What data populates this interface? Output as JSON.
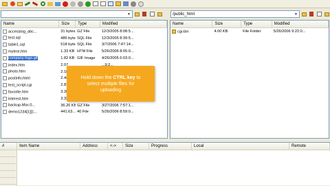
{
  "toolbar": {
    "icons": [
      "folder-icon",
      "wizard-icon",
      "open-icon",
      "connect-icon",
      "disconnect-icon",
      "refresh-icon",
      "upload-icon",
      "download-icon",
      "delete-icon",
      "stop-icon",
      "skip-icon",
      "go-icon",
      "queue-icon",
      "view-icon",
      "log-icon",
      "properties-icon",
      "bookmark-icon",
      "settings-icon",
      "help-icon"
    ]
  },
  "left_path": {
    "value": ""
  },
  "right_path": {
    "value": "/public_html"
  },
  "left_panel": {
    "headers": [
      "Name",
      "Size",
      "Type",
      "Modified"
    ],
    "rows": [
      {
        "name": "accesslog_abc...",
        "size": "31 bytes",
        "type": "GZ File",
        "modified": "12/3/2005 8:08:5..."
      },
      {
        "name": "test.sql",
        "size": "486 bytes",
        "type": "SQL File",
        "modified": "12/3/2005 8:39:5..."
      },
      {
        "name": "table1.sql",
        "size": "518 bytes",
        "type": "SQL File",
        "modified": "3/7/2006 7:47:14..."
      },
      {
        "name": "mytest.htm",
        "size": "1.33 KB",
        "type": "HTM File",
        "modified": "5/26/2006 8:05:0..."
      },
      {
        "name": "company-logo.gif",
        "size": "1.82 KB",
        "type": "GIF Image",
        "modified": "4/26/2005 6:03:0..."
      },
      {
        "name": "index.htm",
        "size": "2.07",
        "type": "",
        "modified": "...9:2..."
      },
      {
        "name": "photo.htm",
        "size": "2.18",
        "type": "",
        "modified": "...11:..."
      },
      {
        "name": "postinfo.html",
        "size": "2.44",
        "type": "",
        "modified": "...9:0..."
      },
      {
        "name": "test_script.cgi",
        "size": "2.81",
        "type": "",
        "modified": "...3:0..."
      },
      {
        "name": "favorite.htm",
        "size": "3.28",
        "type": "",
        "modified": "...8:5..."
      },
      {
        "name": "interest.htm",
        "size": "3.33 KB",
        "type": "HTM File",
        "modified": "5/26/2006 9:15:1..."
      },
      {
        "name": "backup-Mar-0...",
        "size": "36.20 KB",
        "type": "GZ File",
        "modified": "3/27/2006 7:57:1..."
      },
      {
        "name": "demo1234[1][1...",
        "size": "441.63...",
        "type": "40 File",
        "modified": "5/26/2006 8:59:0..."
      }
    ]
  },
  "right_panel": {
    "headers": [
      "Name",
      "Size",
      "Type",
      "Modified"
    ],
    "rows": [
      {
        "name": "cgi-bin",
        "size": "4.00 KB",
        "type": "File Folder",
        "modified": "5/26/2006 9:22:0..."
      }
    ]
  },
  "tooltip": {
    "line1_pre": "Hold down the ",
    "line1_key": "CTRL key",
    "line1_post": " to",
    "line2": "select multiple files for",
    "line3": "uploading"
  },
  "queue": {
    "headers": [
      "#",
      "Item Name",
      "Address",
      "<->",
      "Size",
      "Progress",
      "Local",
      "Remote"
    ]
  }
}
